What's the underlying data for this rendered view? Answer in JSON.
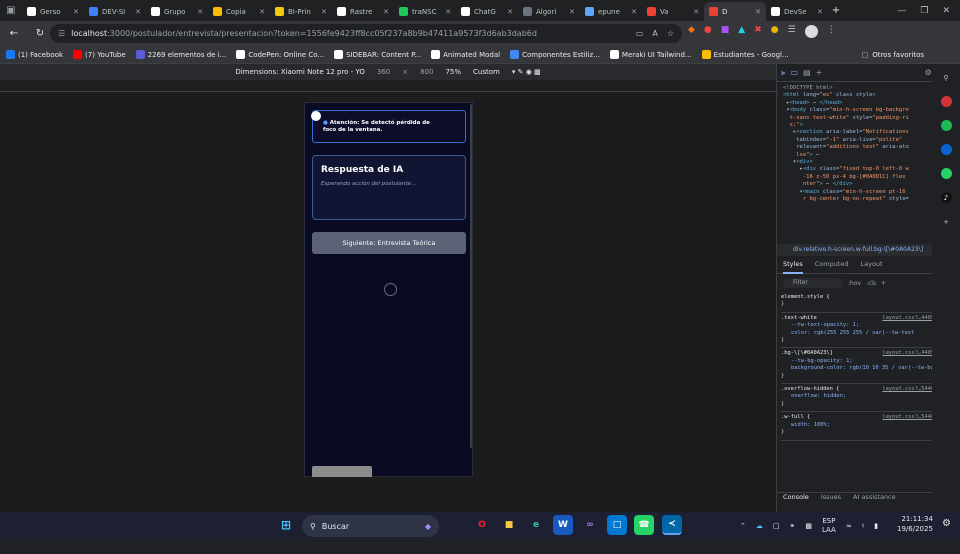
{
  "tabs": [
    {
      "label": "Gerso",
      "icon": "github-icon",
      "color": "#ffffff",
      "active": false
    },
    {
      "label": "DEV-SI",
      "icon": "dev-icon",
      "color": "#3b82f6",
      "active": false
    },
    {
      "label": "Grupo",
      "icon": "google-icon",
      "color": "#ffffff",
      "active": false
    },
    {
      "label": "Copia",
      "icon": "docs-icon",
      "color": "#fbbc04",
      "active": false
    },
    {
      "label": "BI-Prin",
      "icon": "powerbi-icon",
      "color": "#f2c811",
      "active": false
    },
    {
      "label": "Rastre",
      "icon": "google-icon",
      "color": "#ffffff",
      "active": false
    },
    {
      "label": "traNSC",
      "icon": "translate-icon",
      "color": "#22c55e",
      "active": false
    },
    {
      "label": "ChatG",
      "icon": "chatgpt-icon",
      "color": "#ffffff",
      "active": false
    },
    {
      "label": "Algori",
      "icon": "page-icon",
      "color": "#6b7280",
      "active": false
    },
    {
      "label": "epune",
      "icon": "globe-icon",
      "color": "#60a5fa",
      "active": false
    },
    {
      "label": "Va",
      "icon": "gmail-icon",
      "color": "#ea4335",
      "active": false
    },
    {
      "label": "D",
      "icon": "chrome-icon",
      "color": "#e94235",
      "active": true
    },
    {
      "label": "DevSe",
      "icon": "vercel-icon",
      "color": "#ffffff",
      "active": false
    }
  ],
  "address": {
    "host": "localhost",
    "path": ":3000/postulador/entrevista/presentacion?token=1556fe9423ff8cc05f237a8b9b47411a9573f3d6ab3dab6d"
  },
  "bookmarks": [
    {
      "label": "(1) Facebook",
      "color": "#1877f2"
    },
    {
      "label": "(7) YouTube",
      "color": "#ff0000"
    },
    {
      "label": "2269 elementos de i...",
      "color": "#5b5bd6"
    },
    {
      "label": "CodePen: Online Co...",
      "color": "#ffffff"
    },
    {
      "label": "SIDEBAR: Content P...",
      "color": "#ffffff"
    },
    {
      "label": "Animated Modal",
      "color": "#ffffff"
    },
    {
      "label": "Componentes Estiliz...",
      "color": "#4285f4"
    },
    {
      "label": "Meraki UI Tailwind...",
      "color": "#ffffff"
    },
    {
      "label": "Estudiantes - Googl...",
      "color": "#fbbc04"
    }
  ],
  "other_bookmarks": "Otros favoritos",
  "device": {
    "dimensions": "Dimensions: Xiaomi Note 12 pro - YO",
    "width": "360",
    "height": "800",
    "zoom": "75%",
    "throttle": "Custom"
  },
  "app": {
    "alert": "Atención: Se detectó pérdida de foco de la ventana.",
    "ia_title": "Respuesta de IA",
    "ia_text": "Esperando acción del postulante...",
    "next_button": "Siguiente: Entrevista Teórica"
  },
  "devtools": {
    "breadcrumb": "div.relative.h-screen.w-full.bg-\\[\\#0A0A23\\]",
    "style_tabs": [
      "Styles",
      "Computed",
      "Layout"
    ],
    "filter_placeholder": "Filter",
    "filter_hov": ":hov",
    "filter_cls": ".cls",
    "element_style": "element.style {",
    "rules": [
      {
        "selector": ".text-white",
        "source": "layout.css?…440554:1646",
        "props": [
          "--tw-text-opacity: 1;",
          "color: rgb(255 255 255 / var(--tw-text"
        ]
      },
      {
        "selector": ".bg-\\[\\#0A0A23\\]",
        "source": "layout.css?…440554:1108",
        "props": [
          "--tw-bg-opacity: 1;",
          "background-color: rgb(10 10 35 / var(--tw-bg-opac"
        ]
      },
      {
        "selector": ".overflow-hidden {",
        "source": "layout.css?…5440554:986",
        "props": [
          "overflow: hidden;"
        ]
      },
      {
        "selector": ".w-full {",
        "source": "layout.css?…5440554:772",
        "props": [
          "width: 100%;"
        ]
      }
    ],
    "bottom_tabs": [
      "Console",
      "Issues",
      "AI assistance"
    ]
  },
  "taskbar": {
    "search": "Buscar",
    "lang_top": "ESP",
    "lang_bottom": "LAA",
    "time": "21:11:34",
    "date": "19/6/2025"
  }
}
